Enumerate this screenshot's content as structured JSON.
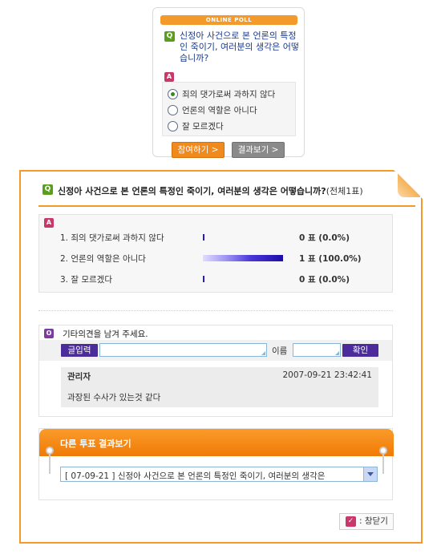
{
  "poll_widget": {
    "title": "ONLINE POLL",
    "q_badge": "Q",
    "a_badge": "A",
    "question": "신정아 사건으로 본 언론의 특정인 죽이기, 여러분의 생각은 어떻습니까?",
    "options": [
      {
        "label": "죄의 댓가로써 과하지 않다",
        "selected": true
      },
      {
        "label": "언론의 역할은 아니다",
        "selected": false
      },
      {
        "label": "잘 모르겠다",
        "selected": false
      }
    ],
    "vote_button": "참여하기 >",
    "result_button": "결과보기 >"
  },
  "results_panel": {
    "q_badge": "Q",
    "question": "신정아 사건으로 본 언론의 특정인 죽이기, 여러분의 생각은 어떻습니까?",
    "total": "(전체1표)",
    "a_badge": "A",
    "results": [
      {
        "label": "1. 죄의 댓가로써 과하지 않다",
        "votes": "0 표 (0.0%)",
        "percent": 0
      },
      {
        "label": "2. 언론의 역할은 아니다",
        "votes": "1 표 (100.0%)",
        "percent": 100
      },
      {
        "label": "3. 잘 모르겠다",
        "votes": "0 표 (0.0%)",
        "percent": 0
      }
    ],
    "bar_color": "#1c0ea8"
  },
  "comments": {
    "o_badge": "O",
    "title": "기타의견을 남겨 주세요.",
    "write_button": "글입력",
    "comment_input_value": "",
    "name_label": "이름",
    "name_input_value": "",
    "confirm_button": "확인",
    "entries": [
      {
        "author": "관리자",
        "date": "2007-09-21 23:42:41",
        "text": "과장된 수사가 있는것 같다"
      }
    ]
  },
  "other_polls": {
    "title": "다른 투표 결과보기",
    "selected": "[ 07-09-21 ] 신정아 사건으로 본 언론의 특정인 죽이기, 여러분의 생각은"
  },
  "close_button": {
    "icon": "✓",
    "label": ": 창닫기"
  },
  "colors": {
    "accent_orange": "#f39a2a",
    "brand_purple": "#4b2c9a",
    "q_green": "#5a9f1c"
  }
}
